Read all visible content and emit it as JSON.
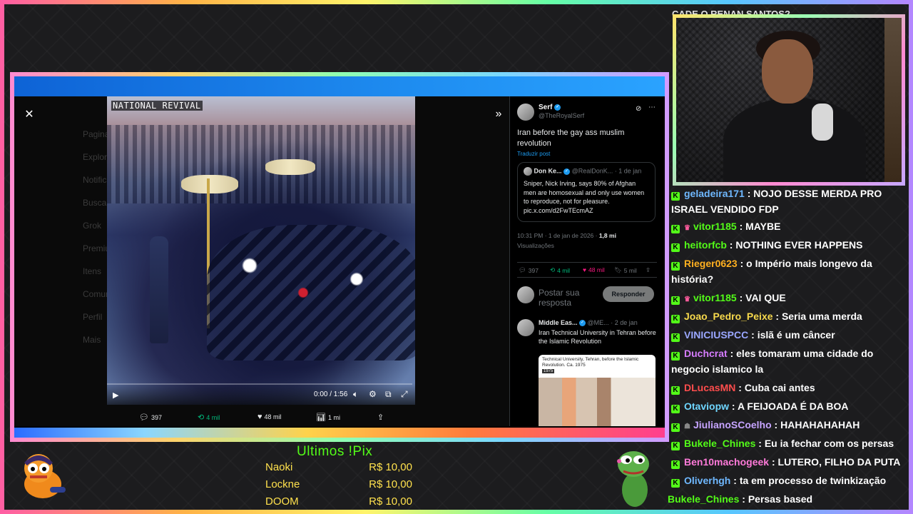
{
  "chat_overflow_text": "CADE O RENAN SANTOS?",
  "video_caption": "NATIONAL REVIVAL",
  "video": {
    "time": "0:00 / 1:56",
    "progress": 0.0
  },
  "x_sidebar_ghost": [
    "Pagina Inicial",
    "Explorar",
    "Notificações",
    "Buscar",
    "Grok",
    "Premium",
    "Itens",
    "Comunidades",
    "Perfil",
    "Mais"
  ],
  "x_stats": {
    "replies": "397",
    "reposts": "4 mil",
    "likes": "48 mil",
    "views": "1 mi"
  },
  "post": {
    "name": "Serf",
    "handle": "@TheRoyalSerf",
    "text": "Iran before the gay ass muslim revolution",
    "translate": "Traduzir post",
    "quote": {
      "name": "Don Ke...",
      "handle": "@RealDonK...",
      "date": "· 1 de jan",
      "text": "Sniper, Nick Irving, says 80% of Afghan men are homosexual and only use women to reproduce, not for pleasure. pic.x.com/d2FwTEcmAZ"
    },
    "timestamp": "10:31 PM · 1 de jan de 2026 · ",
    "views_count": "1,8 mi",
    "views_label": "Visualizações",
    "actions": {
      "replies": "397",
      "reposts": "4 mil",
      "likes": "48 mil",
      "bookmarks": "5 mil"
    },
    "reply_placeholder": "Postar sua resposta",
    "reply_button": "Responder",
    "reply2": {
      "name": "Middle Eas...",
      "handle": "@ME...",
      "date": "· 2 de jan",
      "text": "Iran Technical University in Tehran before the Islamic Revolution",
      "image_caption": "Technical University, Tehran, before the Islamic Revolution. Ca. 1975",
      "image_year": "1975"
    }
  },
  "chat": [
    {
      "user": "geladeira171",
      "color": "#6fb8ff",
      "text": "NOJO DESSE MERDA PRO ISRAEL VENDIDO FDP",
      "badge": ""
    },
    {
      "user": "vitor1185",
      "color": "#53fc18",
      "text": "MAYBE",
      "badge": "♛"
    },
    {
      "user": "heitorfcb",
      "color": "#53fc18",
      "text": "NOTHING EVER HAPPENS",
      "badge": ""
    },
    {
      "user": "Rieger0623",
      "color": "#ffb020",
      "text": "o Império mais longevo da história?",
      "badge": ""
    },
    {
      "user": "vitor1185",
      "color": "#53fc18",
      "text": "VAI QUE",
      "badge": "♛"
    },
    {
      "user": "Joao_Pedro_Peixe",
      "color": "#f7d94c",
      "text": "Seria uma merda",
      "badge": ""
    },
    {
      "user": "VINICIUSPCC",
      "color": "#9aa7ff",
      "text": "islã é um câncer",
      "badge": ""
    },
    {
      "user": "Duchcrat",
      "color": "#d67cff",
      "text": "eles tomaram uma cidade do negocio islamico la",
      "badge": ""
    },
    {
      "user": "DLucasMN",
      "color": "#ff4d4d",
      "text": "Cuba cai antes",
      "badge": ""
    },
    {
      "user": "Otaviopw",
      "color": "#6fd6ff",
      "text": "A FEIJOADA É DA BOA",
      "badge": ""
    },
    {
      "user": "JiulianoSCoelho",
      "color": "#c6a4ff",
      "text": "HAHAHAHAHAH",
      "badge": "☗"
    },
    {
      "user": "Bukele_Chines",
      "color": "#53fc18",
      "text": "Eu ia fechar com os persas",
      "badge": ""
    },
    {
      "user": "Ben10machogeek",
      "color": "#ff7ad9",
      "text": "LUTERO, FILHO DA PUTA",
      "badge": ""
    },
    {
      "user": "Oliverhgh",
      "color": "#6fb8ff",
      "text": "ta em processo de twinkização",
      "badge": ""
    },
    {
      "user": "Bukele_Chines",
      "color": "#53fc18",
      "text": "Persas based",
      "badge": "",
      "no_kick": true
    }
  ],
  "pix": {
    "title": "Ultimos !Pix",
    "rows": [
      {
        "name": "Naoki",
        "amount": "R$ 10,00"
      },
      {
        "name": "Lockne",
        "amount": "R$ 10,00"
      },
      {
        "name": "DOOM",
        "amount": "R$ 10,00"
      }
    ]
  },
  "colors": {
    "accent_green": "#53fc18",
    "x_blue": "#1d9bf0",
    "pix_yellow": "#ffe14d",
    "like_pink": "#f91880",
    "repost_green": "#00ba7c"
  }
}
